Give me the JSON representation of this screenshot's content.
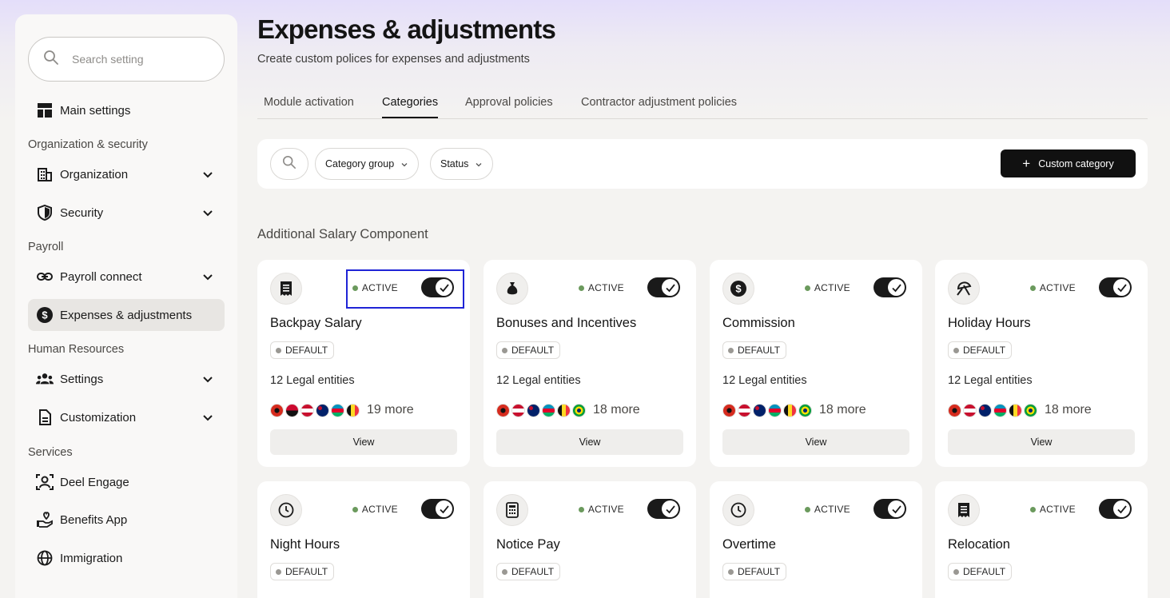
{
  "sidebar": {
    "search_placeholder": "Search setting",
    "main_settings": "Main settings",
    "sections": {
      "org": "Organization & security",
      "payroll": "Payroll",
      "hr": "Human Resources",
      "services": "Services"
    },
    "items": {
      "organization": "Organization",
      "security": "Security",
      "payroll_connect": "Payroll connect",
      "expenses": "Expenses & adjustments",
      "settings": "Settings",
      "customization": "Customization",
      "deel_engage": "Deel Engage",
      "benefits_app": "Benefits App",
      "immigration": "Immigration"
    }
  },
  "header": {
    "title": "Expenses & adjustments",
    "subtitle": "Create custom polices for expenses and adjustments"
  },
  "tabs": [
    "Module activation",
    "Categories",
    "Approval policies",
    "Contractor adjustment policies"
  ],
  "filters": {
    "category_group": "Category group",
    "status": "Status",
    "custom_category": "Custom category"
  },
  "group_title": "Additional Salary Component",
  "colors": {
    "accent": "#111111",
    "active_dot": "#6b9a5d",
    "focus": "#1f24d6"
  },
  "cards": [
    {
      "name": "Backpay Salary",
      "icon": "receipt-icon",
      "status": "ACTIVE",
      "badge": "DEFAULT",
      "entities": "12 Legal entities",
      "more": "19 more",
      "view": "View"
    },
    {
      "name": "Bonuses and Incentives",
      "icon": "money-bag-icon",
      "status": "ACTIVE",
      "badge": "DEFAULT",
      "entities": "12 Legal entities",
      "more": "18 more",
      "view": "View"
    },
    {
      "name": "Commission",
      "icon": "dollar-coin-icon",
      "status": "ACTIVE",
      "badge": "DEFAULT",
      "entities": "12 Legal entities",
      "more": "18 more",
      "view": "View"
    },
    {
      "name": "Holiday Hours",
      "icon": "beach-umbrella-icon",
      "status": "ACTIVE",
      "badge": "DEFAULT",
      "entities": "12 Legal entities",
      "more": "18 more",
      "view": "View"
    },
    {
      "name": "Night Hours",
      "icon": "clock-icon",
      "status": "ACTIVE",
      "badge": "DEFAULT"
    },
    {
      "name": "Notice Pay",
      "icon": "calculator-icon",
      "status": "ACTIVE",
      "badge": "DEFAULT"
    },
    {
      "name": "Overtime",
      "icon": "clock-icon",
      "status": "ACTIVE",
      "badge": "DEFAULT"
    },
    {
      "name": "Relocation",
      "icon": "receipt-icon",
      "status": "ACTIVE",
      "badge": "DEFAULT"
    }
  ]
}
